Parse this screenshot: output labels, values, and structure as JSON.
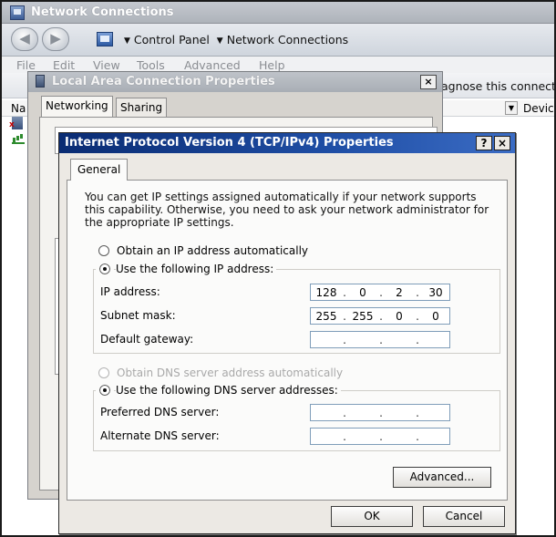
{
  "network_connections": {
    "title": "Network Connections",
    "breadcrumb": [
      "Control Panel",
      "Network Connections"
    ],
    "menu": [
      "File",
      "Edit",
      "View",
      "Tools",
      "Advanced",
      "Help"
    ],
    "toolbar_text": "agnose this connectio",
    "column_name_partial": "Na",
    "column_device_partial": "Devic",
    "icons": {
      "back": "back-arrow-icon",
      "forward": "forward-arrow-icon"
    }
  },
  "local_area": {
    "title": "Local Area Connection Properties",
    "tabs": [
      "Networking",
      "Sharing"
    ],
    "close_label": "×"
  },
  "dialog": {
    "title": "Internet Protocol Version 4 (TCP/IPv4) Properties",
    "help_label": "?",
    "close_label": "×",
    "tab": "General",
    "intro": "You can get IP settings assigned automatically if your network supports this capability. Otherwise, you need to ask your network administrator for the appropriate IP settings.",
    "ip_auto_label": "Obtain an IP address automatically",
    "ip_manual_label": "Use the following IP address:",
    "ip_fields": [
      {
        "label": "IP address:",
        "octets": [
          "128",
          "0",
          "2",
          "30"
        ]
      },
      {
        "label": "Subnet mask:",
        "octets": [
          "255",
          "255",
          "0",
          "0"
        ]
      },
      {
        "label": "Default gateway:",
        "octets": [
          "",
          "",
          "",
          ""
        ]
      }
    ],
    "dns_auto_label": "Obtain DNS server address automatically",
    "dns_manual_label": "Use the following DNS server addresses:",
    "dns_fields": [
      {
        "label": "Preferred DNS server:",
        "octets": [
          "",
          "",
          "",
          ""
        ]
      },
      {
        "label": "Alternate DNS server:",
        "octets": [
          "",
          "",
          "",
          ""
        ]
      }
    ],
    "advanced_label": "Advanced...",
    "ok_label": "OK",
    "cancel_label": "Cancel",
    "selection": {
      "ip_mode": "manual",
      "dns_mode": "manual"
    }
  }
}
